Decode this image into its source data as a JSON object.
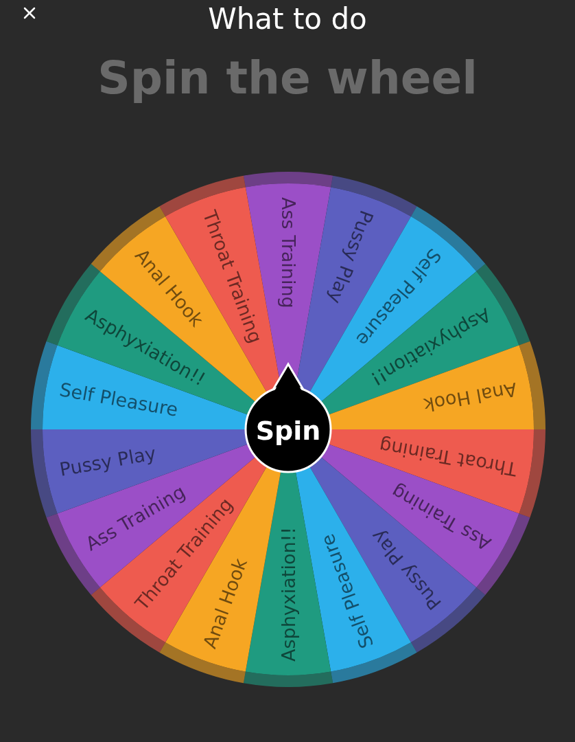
{
  "header": {
    "title": "What to do",
    "subtitle": "Spin the wheel"
  },
  "wheel": {
    "button_label": "Spin",
    "segments": [
      {
        "label": "Ass Training",
        "color": "#9b4fc7"
      },
      {
        "label": "Pussy Play",
        "color": "#5c5fc0"
      },
      {
        "label": "Self Pleasure",
        "color": "#2cb0eb"
      },
      {
        "label": "Asphyxiation!!",
        "color": "#1f9b80"
      },
      {
        "label": "Anal Hook",
        "color": "#f6a623"
      },
      {
        "label": "Throat Training",
        "color": "#ee5b4f"
      },
      {
        "label": "Ass Training",
        "color": "#9b4fc7"
      },
      {
        "label": "Pussy Play",
        "color": "#5c5fc0"
      },
      {
        "label": "Self Pleasure",
        "color": "#2cb0eb"
      },
      {
        "label": "Asphyxiation!!",
        "color": "#1f9b80"
      },
      {
        "label": "Anal Hook",
        "color": "#f6a623"
      },
      {
        "label": "Throat Training",
        "color": "#ee5b4f"
      },
      {
        "label": "Ass Training",
        "color": "#9b4fc7"
      },
      {
        "label": "Pussy Play",
        "color": "#5c5fc0"
      },
      {
        "label": "Self Pleasure",
        "color": "#2cb0eb"
      },
      {
        "label": "Asphyxiation!!",
        "color": "#1f9b80"
      },
      {
        "label": "Anal Hook",
        "color": "#f6a623"
      },
      {
        "label": "Throat Training",
        "color": "#ee5b4f"
      }
    ]
  }
}
